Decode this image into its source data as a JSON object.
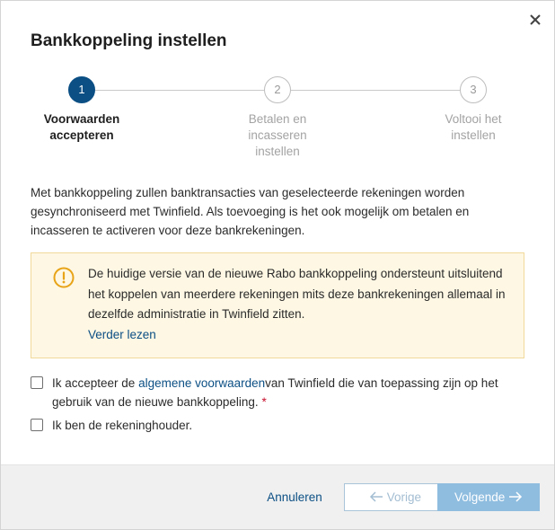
{
  "dialog": {
    "title": "Bankkoppeling instellen",
    "close_icon": "close-icon"
  },
  "stepper": {
    "steps": [
      {
        "number": "1",
        "line1": "Voorwaarden",
        "line2": "accepteren",
        "line3": "",
        "state": "active"
      },
      {
        "number": "2",
        "line1": "Betalen en",
        "line2": "incasseren",
        "line3": "instellen",
        "state": "inactive"
      },
      {
        "number": "3",
        "line1": "Voltooi het",
        "line2": "instellen",
        "line3": "",
        "state": "inactive"
      }
    ]
  },
  "intro": {
    "text": "Met bankkoppeling zullen banktransacties van geselecteerde rekeningen worden gesynchroniseerd met Twinfield. Als toevoeging is het ook mogelijk om betalen en incasseren te activeren voor deze bankrekeningen."
  },
  "warning": {
    "icon": "warning-icon",
    "text": "De huidige versie van de nieuwe Rabo bankkoppeling ondersteunt uitsluitend het koppelen van meerdere rekeningen mits deze bankrekeningen allemaal in dezelfde administratie in Twinfield zitten.",
    "link": "Verder lezen"
  },
  "terms": {
    "prefix": "Ik accepteer de ",
    "link": "algemene voorwaarden",
    "suffix": "van Twinfield die van toepassing zijn op het gebruik van de nieuwe bankkoppeling.",
    "required_mark": "*",
    "checked": false
  },
  "holder": {
    "label": "Ik ben de rekeninghouder.",
    "checked": false
  },
  "footer": {
    "cancel_label": "Annuleren",
    "prev_label": "Vorige",
    "next_label": "Volgende"
  },
  "colors": {
    "accent": "#0b4f84",
    "warning_bg": "#fdf7e3",
    "warning_border": "#f0d99a",
    "warning_icon": "#e8a317",
    "required": "#c8102e",
    "next_button": "#8fbde0"
  }
}
